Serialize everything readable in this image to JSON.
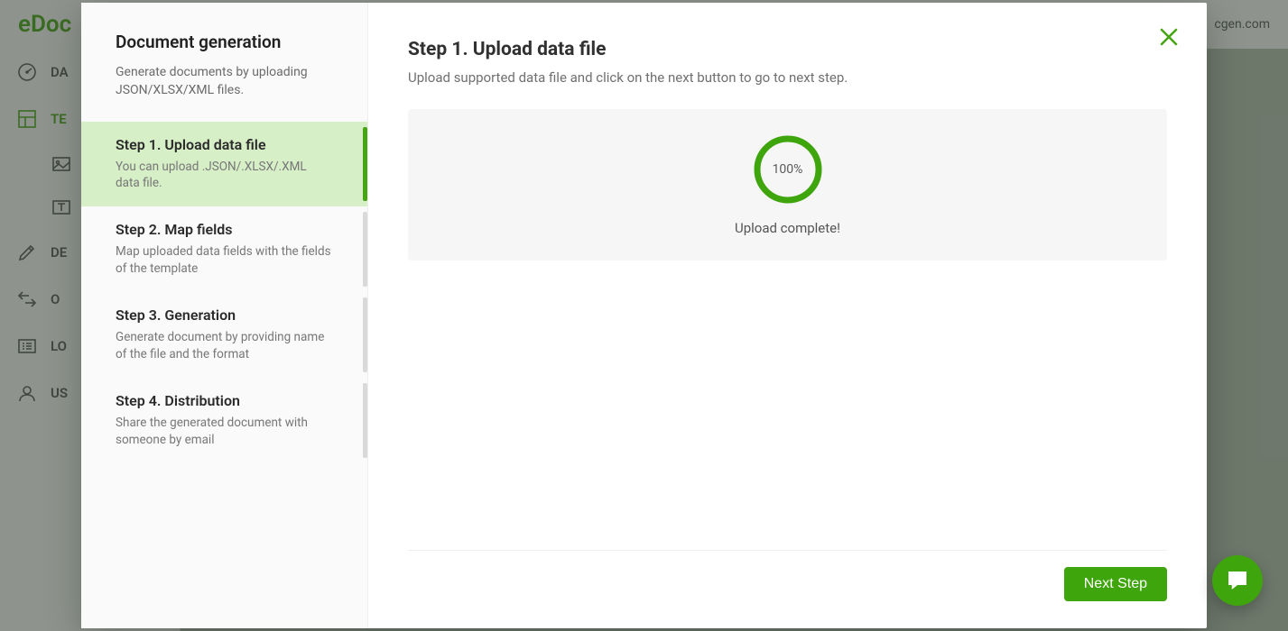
{
  "brand": {
    "logo_text": "eDoc"
  },
  "header": {
    "right_text": "cgen.com"
  },
  "sidebar": {
    "items": [
      {
        "label_short": "DA"
      },
      {
        "label_short": "TE"
      },
      {
        "label_short": ""
      },
      {
        "label_short": ""
      },
      {
        "label_short": "DE"
      },
      {
        "label_short": "O"
      },
      {
        "label_short": "LO"
      },
      {
        "label_short": "US"
      }
    ]
  },
  "modal": {
    "left": {
      "title": "Document generation",
      "subtitle": "Generate documents by uploading JSON/XLSX/XML files.",
      "steps": [
        {
          "title": "Step 1. Upload data file",
          "desc": "You can upload .JSON/.XLSX/.XML data file.",
          "active": true
        },
        {
          "title": "Step 2. Map fields",
          "desc": "Map uploaded data fields with the fields of the template",
          "active": false
        },
        {
          "title": "Step 3. Generation",
          "desc": "Generate document by providing name of the file and the format",
          "active": false
        },
        {
          "title": "Step 4. Distribution",
          "desc": "Share the generated document with someone by email",
          "active": false
        }
      ]
    },
    "right": {
      "title": "Step 1. Upload data file",
      "subtitle": "Upload supported data file and click on the next button to go to next step.",
      "progress_percent": 100,
      "progress_text": "100%",
      "status_text": "Upload complete!",
      "next_label": "Next Step"
    }
  },
  "colors": {
    "accent": "#3fa50c"
  }
}
